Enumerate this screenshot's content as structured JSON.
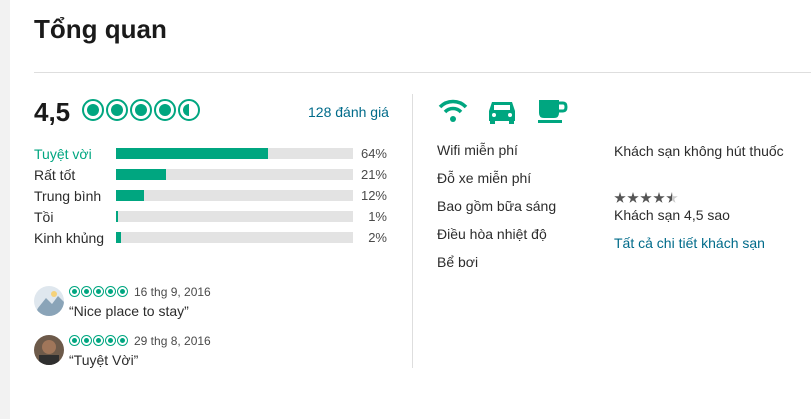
{
  "header": {
    "title": "Tổng quan"
  },
  "rating": {
    "value": "4,5",
    "bubble_score": 4.5,
    "review_count": "128 đánh giá"
  },
  "distribution": [
    {
      "label": "Tuyệt vời",
      "percent": "64%",
      "fraction": 0.64
    },
    {
      "label": "Rất tốt",
      "percent": "21%",
      "fraction": 0.21
    },
    {
      "label": "Trung bình",
      "percent": "12%",
      "fraction": 0.12
    },
    {
      "label": "Tồi",
      "percent": "1%",
      "fraction": 0.01
    },
    {
      "label": "Kinh khủng",
      "percent": "2%",
      "fraction": 0.02
    }
  ],
  "snippets": [
    {
      "date": "16 thg 9, 2016",
      "quote": "“Nice place to stay”",
      "rating": 5
    },
    {
      "date": "29 thg 8, 2016",
      "quote": "“Tuyệt Vời”",
      "rating": 5
    }
  ],
  "amenities": {
    "icons": [
      "wifi-icon",
      "car-icon",
      "coffee-cup-icon"
    ],
    "accent_color": "#00a680",
    "items": [
      "Wifi miễn phí",
      "Đỗ xe miễn phí",
      "Bao gồm bữa sáng",
      "Điều hòa nhiệt độ",
      "Bể bơi"
    ]
  },
  "hotel_info": {
    "non_smoking": "Khách sạn không hút thuốc",
    "star_rating": 4.5,
    "class_text": "Khách sạn 4,5 sao",
    "details_link": "Tất cả chi tiết khách sạn"
  },
  "colors": {
    "brand_green": "#00a680",
    "link_blue": "#006b8a"
  }
}
